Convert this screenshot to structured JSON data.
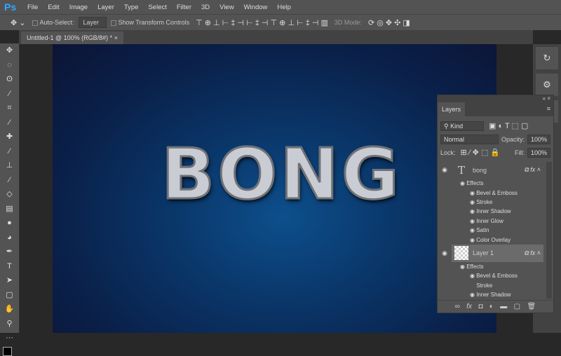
{
  "app": {
    "logo": "Ps",
    "menu": [
      "File",
      "Edit",
      "Image",
      "Layer",
      "Type",
      "Select",
      "Filter",
      "3D",
      "View",
      "Window",
      "Help"
    ]
  },
  "options": {
    "auto_select": "Auto-Select:",
    "auto_select_value": "Layer",
    "show_transform": "Show Transform Controls",
    "mode_3d": "3D Mode:"
  },
  "document": {
    "tab": "Untitled-1 @ 100% (RGB/8#) *",
    "text": "BONG",
    "colors": {
      "bg_center": "#0d4f8c",
      "bg_edge": "#0c1435"
    }
  },
  "tools": [
    "move",
    "marquee",
    "lasso",
    "magic-wand",
    "crop",
    "eyedropper",
    "healing",
    "brush",
    "stamp",
    "history-brush",
    "eraser",
    "gradient",
    "blur",
    "dodge",
    "pen",
    "type",
    "path-select",
    "rectangle",
    "hand",
    "zoom",
    "more"
  ],
  "layers": {
    "tab": "Layers",
    "filter": "Kind",
    "blend": "Normal",
    "opacity_label": "Opacity:",
    "opacity": "100%",
    "lock_label": "Lock:",
    "fill_label": "Fill:",
    "fill": "100%",
    "items": [
      {
        "name": "bong",
        "type": "text",
        "effects_label": "Effects",
        "effects": [
          "Bevel & Emboss",
          "Stroke",
          "Inner Shadow",
          "Inner Glow",
          "Satin",
          "Color Overlay"
        ]
      },
      {
        "name": "Layer 1",
        "type": "raster",
        "effects_label": "Effects",
        "effects": [
          "Bevel & Emboss",
          "Stroke",
          "Inner Shadow"
        ]
      }
    ]
  }
}
